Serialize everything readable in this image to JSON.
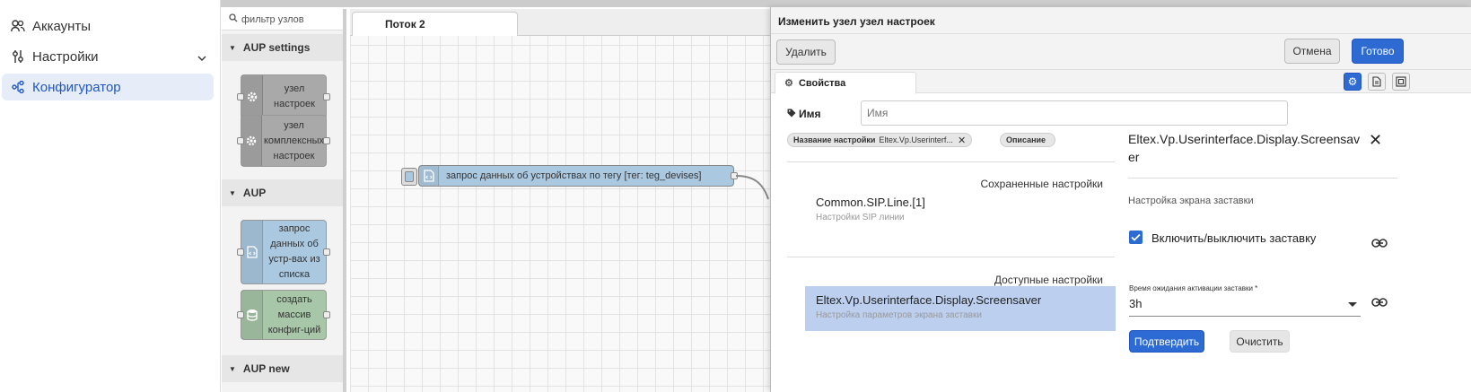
{
  "sidebar": {
    "items": [
      {
        "label": "Аккаунты",
        "icon": "users-icon"
      },
      {
        "label": "Настройки",
        "icon": "sliders-icon"
      },
      {
        "label": "Конфигуратор",
        "icon": "flow-icon"
      }
    ]
  },
  "palette": {
    "filter_placeholder": "фильтр узлов",
    "categories": [
      {
        "label": "AUP settings"
      },
      {
        "label": "AUP"
      },
      {
        "label": "AUP new"
      }
    ],
    "nodes": [
      {
        "label": "узел настроек",
        "color": "#a9a9a9"
      },
      {
        "label": "узел комплексных настроек",
        "color": "#a9a9a9"
      },
      {
        "label": "запрос данных об устр-вах из списка",
        "color": "#aac8e0"
      },
      {
        "label": "создать массив конфиг-ций",
        "color": "#a8c6a8"
      }
    ]
  },
  "workspace": {
    "tab_label": "Поток 2",
    "flow_node_label": "запрос данных об устройствах по тегу [тег: teg_devises]"
  },
  "tray": {
    "title": "Изменить узел узел настроек",
    "delete_label": "Удалить",
    "cancel_label": "Отмена",
    "done_label": "Готово",
    "tab_label": "Свойства",
    "name_label": "Имя",
    "name_placeholder": "Имя",
    "chips": [
      {
        "bold": "Название настройки",
        "value": "Eltex.Vp.Userinterf..."
      },
      {
        "bold": "Описание",
        "value": ""
      }
    ],
    "saved_title": "Сохраненные настройки",
    "saved_items": [
      {
        "title": "Common.SIP.Line.[1]",
        "subtitle": "Настройки SIP линии"
      }
    ],
    "available_title": "Доступные настройки",
    "available_items": [
      {
        "title": "Eltex.Vp.Userinterface.Display.Screensaver",
        "subtitle": "Настройка параметров экрана заставки"
      }
    ],
    "detail": {
      "title": "Eltex.Vp.Userinterface.Display.Screensaver",
      "description": "Настройка экрана заставки",
      "checkbox_label": "Включить/выключить заставку",
      "checkbox_checked": true,
      "select_label": "Время ожидания активации заставки *",
      "select_value": "3h",
      "confirm_label": "Подтвердить",
      "clear_label": "Очистить"
    }
  },
  "colors": {
    "accent": "#2d6bd3",
    "selected_row": "#bccfee"
  }
}
